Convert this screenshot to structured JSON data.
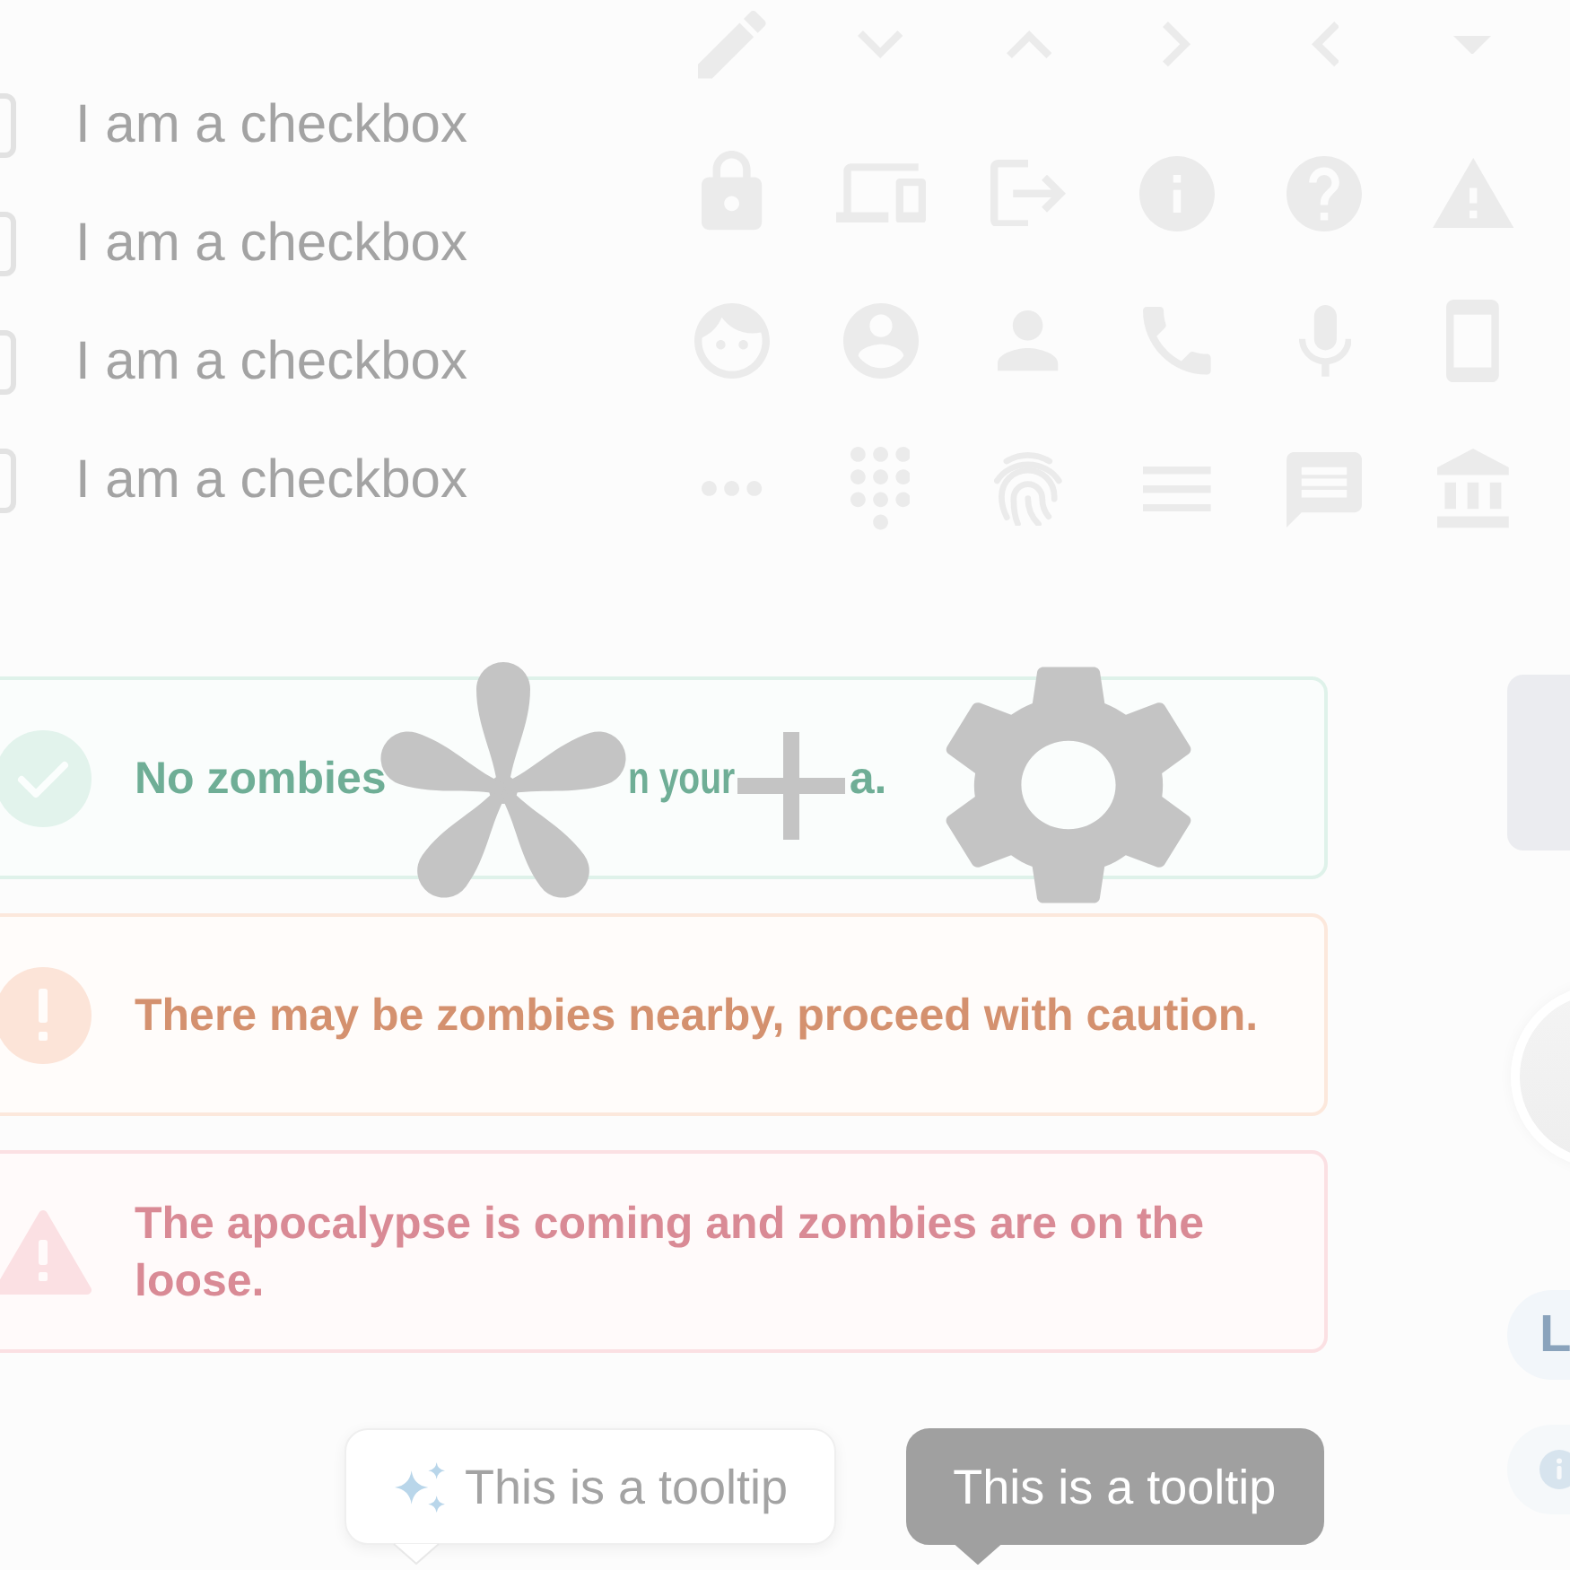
{
  "checkboxes": [
    {
      "label": "I am a checkbox",
      "checked": false
    },
    {
      "label": "I am a checkbox",
      "checked": false
    },
    {
      "label": "I am a checkbox",
      "checked": false
    },
    {
      "label": "I am a checkbox",
      "checked": false
    }
  ],
  "alerts": [
    {
      "kind": "success",
      "visible_text": [
        "No zombies",
        "n your",
        "a."
      ]
    },
    {
      "kind": "warning",
      "text": "There may be zombies nearby, proceed with caution."
    },
    {
      "kind": "error",
      "text": "The apocalypse is coming and zombies are on the loose."
    }
  ],
  "tooltips": [
    {
      "kind": "light",
      "text": "This is a tooltip"
    },
    {
      "kind": "dark",
      "text": "This is a tooltip"
    }
  ],
  "side_panel": {
    "chips": [
      {
        "kind": "label",
        "label": "L"
      },
      {
        "kind": "icon"
      }
    ]
  }
}
